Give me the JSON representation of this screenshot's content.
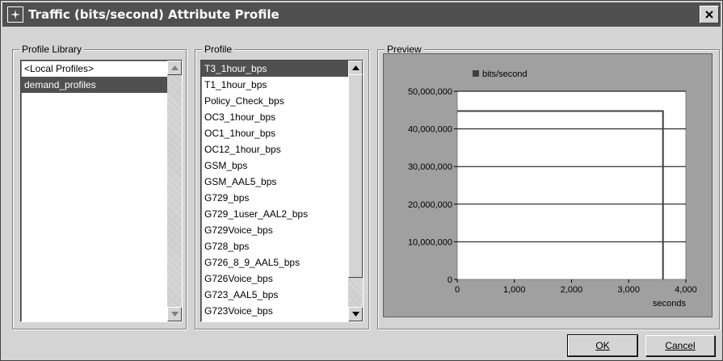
{
  "window": {
    "title": "Traffic (bits/second) Attribute Profile"
  },
  "profile_library": {
    "label": "Profile Library",
    "items": [
      "<Local Profiles>",
      "demand_profiles"
    ],
    "selected_index": 1
  },
  "profile": {
    "label": "Profile",
    "items": [
      "T3_1hour_bps",
      "T1_1hour_bps",
      "Policy_Check_bps",
      "OC3_1hour_bps",
      "OC1_1hour_bps",
      "OC12_1hour_bps",
      "GSM_bps",
      "GSM_AAL5_bps",
      "G729_bps",
      "G729_1user_AAL2_bps",
      "G729Voice_bps",
      "G728_bps",
      "G726_8_9_AAL5_bps",
      "G726Voice_bps",
      "G723_AAL5_bps",
      "G723Voice_bps"
    ],
    "selected_index": 0
  },
  "preview": {
    "label": "Preview"
  },
  "buttons": {
    "ok": "OK",
    "cancel": "Cancel"
  },
  "colors": {
    "titlebar": "#505050",
    "chart_line": "#404040",
    "plot_bg": "#ffffff",
    "frame_bg": "#a0a0a0"
  },
  "chart_data": {
    "type": "line",
    "title": "",
    "legend": [
      "bits/second"
    ],
    "legend_position": "top-center",
    "xlabel": "seconds",
    "ylabel": "",
    "xlim": [
      0,
      4000
    ],
    "ylim": [
      0,
      50000000
    ],
    "x_ticks": [
      "0",
      "1,000",
      "2,000",
      "3,000",
      "4,000"
    ],
    "y_ticks": [
      "0",
      "10,000,000",
      "20,000,000",
      "30,000,000",
      "40,000,000",
      "50,000,000"
    ],
    "grid": "horizontal",
    "series": [
      {
        "name": "bits/second",
        "x": [
          0,
          3600,
          3600
        ],
        "y": [
          44736000,
          44736000,
          0
        ]
      }
    ]
  }
}
